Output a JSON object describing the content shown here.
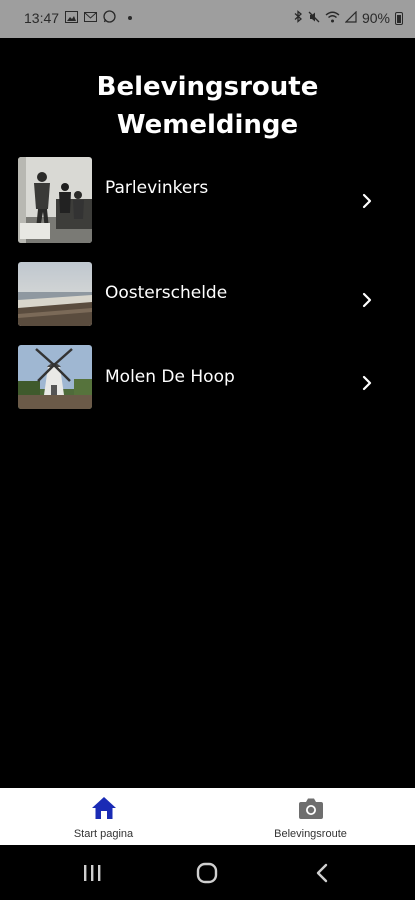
{
  "status_bar": {
    "time": "13:47",
    "battery": "90%"
  },
  "page": {
    "title": "Belevingsroute\nWemeldinge"
  },
  "routes": [
    {
      "label": "Parlevinkers",
      "image": "historic-photo-men-on-boat"
    },
    {
      "label": "Oosterschelde",
      "image": "photo-sea-shore"
    },
    {
      "label": "Molen De Hoop",
      "image": "photo-windmill"
    }
  ],
  "bottom_nav": {
    "items": [
      {
        "label": "Start pagina",
        "icon": "home-icon",
        "color": "#1a2bb5",
        "active": true
      },
      {
        "label": "Belevingsroute",
        "icon": "camera-icon",
        "color": "#6e6e6e",
        "active": false
      }
    ]
  },
  "system_nav": {
    "items": [
      "recent-apps-icon",
      "home-circle-icon",
      "back-icon"
    ]
  }
}
